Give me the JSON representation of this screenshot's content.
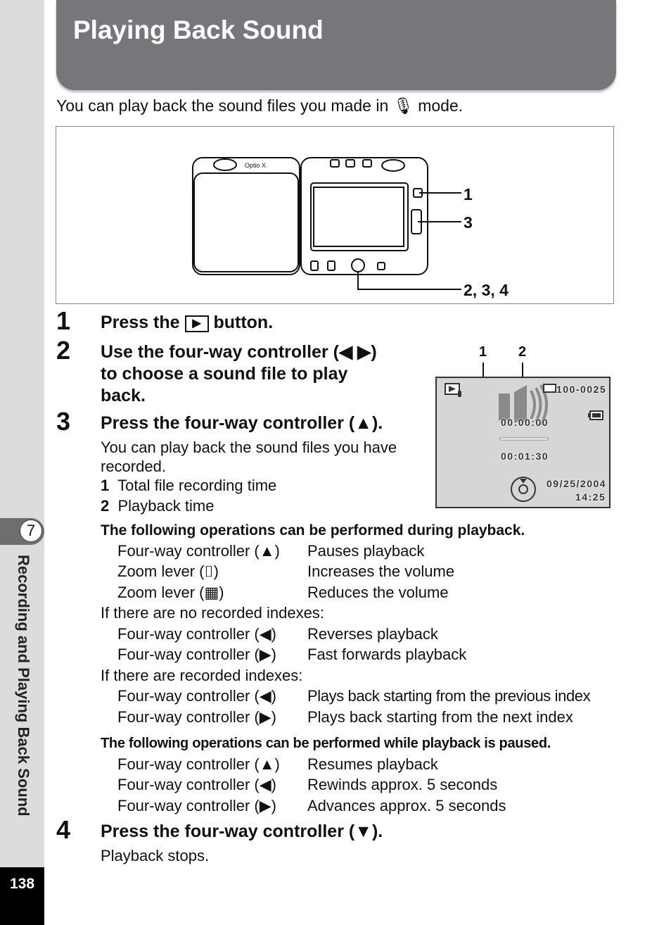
{
  "header": {
    "title": "Playing Back Sound"
  },
  "intro": {
    "before_icon": "You can play back the sound files you made in",
    "icon": "microphone-icon",
    "after_icon": "mode."
  },
  "figure": {
    "brand": "Optio X",
    "callouts": [
      "1",
      "3",
      "2, 3, 4"
    ]
  },
  "steps": [
    {
      "num": "1",
      "text_before": "Press the",
      "icon": "playback-button-icon",
      "text_after": "button."
    },
    {
      "num": "2",
      "lines": [
        "Use the four-way controller (◀ ▶)",
        "to choose a sound file to play",
        "back."
      ]
    },
    {
      "num": "3",
      "text": "Press the four-way controller (▲).",
      "desc_lines": [
        "You can play back the sound files you have",
        "recorded."
      ],
      "legend": [
        {
          "num": "1",
          "label": "Total file recording time"
        },
        {
          "num": "2",
          "label": "Playback time"
        }
      ]
    },
    {
      "num": "4",
      "text": "Press the four-way controller (▼).",
      "desc": "Playback stops."
    }
  ],
  "lcd": {
    "callouts": [
      "1",
      "2"
    ],
    "file_number": "100-0025",
    "playback_time": "00:00:00",
    "total_time": "00:01:30",
    "date": "09/25/2004",
    "time": "14:25"
  },
  "ops_playback": {
    "heading": "The following operations can be performed during playback.",
    "rows": [
      {
        "control": "Four-way controller (▲)",
        "action": "Pauses playback"
      },
      {
        "control": "Zoom lever (⌷)",
        "action": "Increases the volume"
      },
      {
        "control": "Zoom lever (▦)",
        "action": "Reduces the volume"
      }
    ],
    "no_index_label": "If there are no recorded indexes:",
    "no_index_rows": [
      {
        "control": "Four-way controller (◀)",
        "action": "Reverses playback"
      },
      {
        "control": "Four-way controller (▶)",
        "action": "Fast forwards playback"
      }
    ],
    "index_label": "If there are recorded indexes:",
    "index_rows": [
      {
        "control": "Four-way controller (◀)",
        "action": "Plays back starting from the previous index"
      },
      {
        "control": "Four-way controller (▶)",
        "action": "Plays back starting from the next index"
      }
    ]
  },
  "ops_paused": {
    "heading": "The following operations can be performed while playback is paused.",
    "rows": [
      {
        "control": "Four-way controller (▲)",
        "action": "Resumes playback"
      },
      {
        "control": "Four-way controller (◀)",
        "action": "Rewinds approx. 5 seconds"
      },
      {
        "control": "Four-way controller (▶)",
        "action": "Advances approx. 5 seconds"
      }
    ]
  },
  "sidebar": {
    "chapter_number": "7",
    "chapter_title": "Recording and Playing Back Sound",
    "page_number": "138"
  }
}
